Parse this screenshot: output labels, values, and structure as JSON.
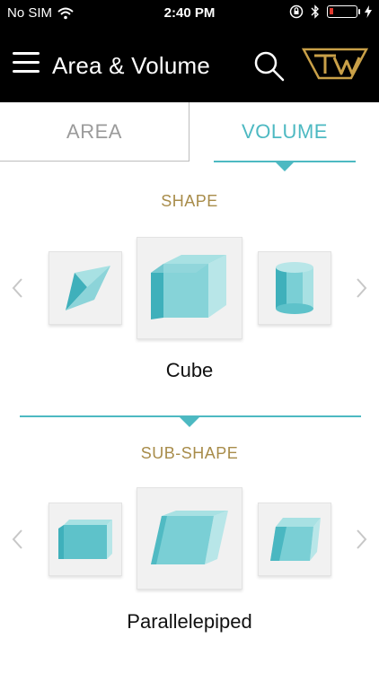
{
  "status_bar": {
    "carrier": "No SIM",
    "time": "2:40 PM"
  },
  "header": {
    "title": "Area & Volume",
    "logo_letters": "TW"
  },
  "tabs": [
    {
      "label": "AREA",
      "selected": false
    },
    {
      "label": "VOLUME",
      "selected": true
    }
  ],
  "shape_section": {
    "label": "SHAPE",
    "selected_name": "Cube",
    "icons": [
      "prism-icon",
      "cube-icon",
      "cylinder-icon"
    ]
  },
  "subshape_section": {
    "label": "SUB-SHAPE",
    "selected_name": "Parallelepiped",
    "icons": [
      "rectangular-box-icon",
      "parallelepiped-icon",
      "oblique-box-icon"
    ]
  },
  "colors": {
    "accent": "#4db9c2",
    "label_gold": "#a88c4a",
    "header_bg": "#000000",
    "battery_low": "#e03a2f"
  }
}
